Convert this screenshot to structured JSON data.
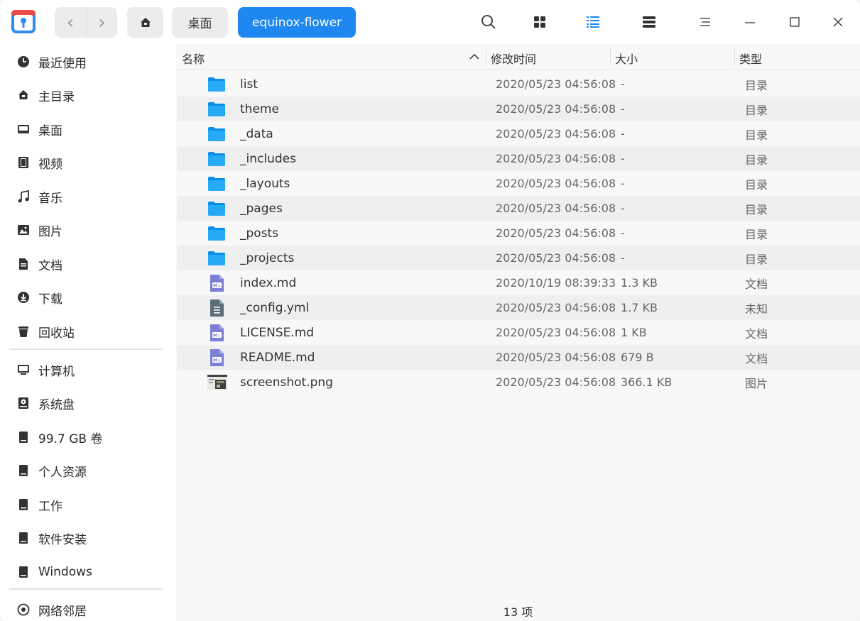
{
  "toolbar": {
    "back_label": "‹",
    "forward_label": "›",
    "breadcrumbs": [
      {
        "label": "桌面"
      },
      {
        "label": "equinox-flower"
      }
    ],
    "accent_color": "#1e87f0"
  },
  "sidebar": {
    "items": [
      {
        "label": "最近使用",
        "icon": "clock-icon"
      },
      {
        "label": "主目录",
        "icon": "home-icon"
      },
      {
        "label": "桌面",
        "icon": "desktop-icon"
      },
      {
        "label": "视频",
        "icon": "video-icon"
      },
      {
        "label": "音乐",
        "icon": "music-icon"
      },
      {
        "label": "图片",
        "icon": "picture-icon"
      },
      {
        "label": "文档",
        "icon": "document-icon"
      },
      {
        "label": "下载",
        "icon": "download-icon"
      },
      {
        "label": "回收站",
        "icon": "trash-icon"
      }
    ],
    "devices": [
      {
        "label": "计算机",
        "icon": "computer-icon"
      },
      {
        "label": "系统盘",
        "icon": "system-disk-icon"
      },
      {
        "label": "99.7 GB 卷",
        "icon": "drive-icon"
      },
      {
        "label": "个人资源",
        "icon": "drive-icon"
      },
      {
        "label": "工作",
        "icon": "drive-icon"
      },
      {
        "label": "软件安装",
        "icon": "drive-icon"
      },
      {
        "label": "Windows",
        "icon": "drive-icon"
      }
    ],
    "network": [
      {
        "label": "网络邻居",
        "icon": "network-icon"
      }
    ]
  },
  "file_list": {
    "columns": {
      "name": "名称",
      "modified": "修改时间",
      "size": "大小",
      "type": "类型"
    },
    "rows": [
      {
        "name": "list",
        "modified": "2020/05/23 04:56:08",
        "size": "-",
        "type": "目录",
        "icon": "folder-icon"
      },
      {
        "name": "theme",
        "modified": "2020/05/23 04:56:08",
        "size": "-",
        "type": "目录",
        "icon": "folder-icon"
      },
      {
        "name": "_data",
        "modified": "2020/05/23 04:56:08",
        "size": "-",
        "type": "目录",
        "icon": "folder-icon"
      },
      {
        "name": "_includes",
        "modified": "2020/05/23 04:56:08",
        "size": "-",
        "type": "目录",
        "icon": "folder-icon"
      },
      {
        "name": "_layouts",
        "modified": "2020/05/23 04:56:08",
        "size": "-",
        "type": "目录",
        "icon": "folder-icon"
      },
      {
        "name": "_pages",
        "modified": "2020/05/23 04:56:08",
        "size": "-",
        "type": "目录",
        "icon": "folder-icon"
      },
      {
        "name": "_posts",
        "modified": "2020/05/23 04:56:08",
        "size": "-",
        "type": "目录",
        "icon": "folder-icon"
      },
      {
        "name": "_projects",
        "modified": "2020/05/23 04:56:08",
        "size": "-",
        "type": "目录",
        "icon": "folder-icon"
      },
      {
        "name": "index.md",
        "modified": "2020/10/19 08:39:33",
        "size": "1.3 KB",
        "type": "文档",
        "icon": "markdown-file-icon"
      },
      {
        "name": "_config.yml",
        "modified": "2020/05/23 04:56:08",
        "size": "1.7 KB",
        "type": "未知",
        "icon": "text-file-icon"
      },
      {
        "name": "LICENSE.md",
        "modified": "2020/05/23 04:56:08",
        "size": "1 KB",
        "type": "文档",
        "icon": "markdown-file-icon"
      },
      {
        "name": "README.md",
        "modified": "2020/05/23 04:56:08",
        "size": "679 B",
        "type": "文档",
        "icon": "markdown-file-icon"
      },
      {
        "name": "screenshot.png",
        "modified": "2020/05/23 04:56:08",
        "size": "366.1 KB",
        "type": "图片",
        "icon": "image-thumbnail-icon"
      }
    ]
  },
  "status": {
    "item_count": "13 项"
  }
}
